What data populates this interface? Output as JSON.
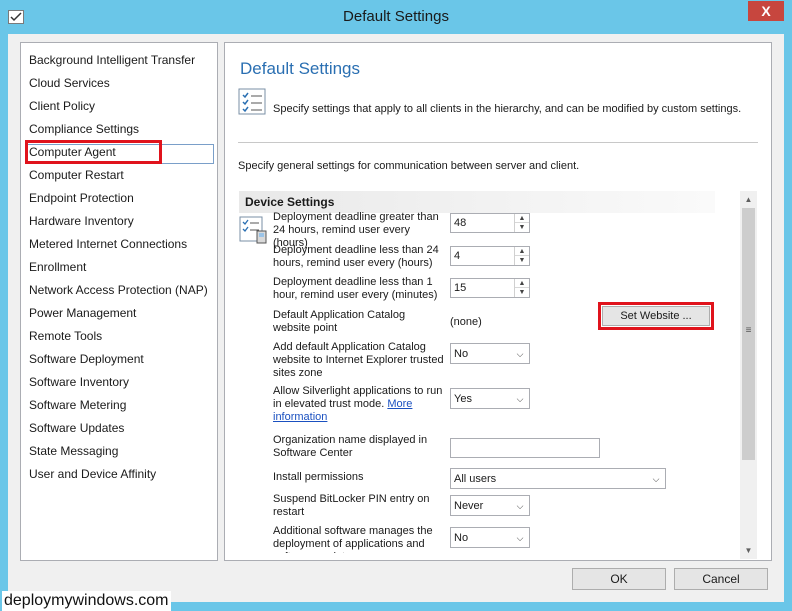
{
  "window": {
    "title": "Default Settings",
    "close_label": "X"
  },
  "nav": {
    "items": [
      "Background Intelligent Transfer",
      "Cloud Services",
      "Client Policy",
      "Compliance Settings",
      "Computer Agent",
      "Computer Restart",
      "Endpoint Protection",
      "Hardware Inventory",
      "Metered Internet Connections",
      "Enrollment",
      "Network Access Protection (NAP)",
      "Power Management",
      "Remote Tools",
      "Software Deployment",
      "Software Inventory",
      "Software Metering",
      "Software Updates",
      "State Messaging",
      "User and Device Affinity"
    ],
    "selected": "Computer Agent"
  },
  "panel": {
    "title": "Default Settings",
    "description": "Specify settings that apply to all clients in the hierarchy, and can be modified by custom settings.",
    "subdescription": "Specify general settings for communication between server and client.",
    "group_title": "Device Settings",
    "settings": {
      "deadline_greater_label": "Deployment deadline greater than 24 hours, remind user every (hours)",
      "deadline_greater_value": "48",
      "deadline_less24_label": "Deployment deadline less than 24 hours, remind user every (hours)",
      "deadline_less24_value": "4",
      "deadline_less1_label": "Deployment deadline less than 1 hour, remind user every (minutes)",
      "deadline_less1_value": "15",
      "catalog_point_label": "Default Application Catalog website point",
      "catalog_point_value": "(none)",
      "set_website_label": "Set Website ...",
      "add_catalog_label": "Add default Application Catalog website to Internet Explorer trusted sites zone",
      "add_catalog_value": "No",
      "silverlight_label": "Allow Silverlight applications to run in elevated trust mode.",
      "silverlight_link": "More information",
      "silverlight_value": "Yes",
      "org_name_label": "Organization name displayed in Software Center",
      "org_name_value": "",
      "install_perm_label": "Install permissions",
      "install_perm_value": "All users",
      "bitlocker_label": "Suspend BitLocker PIN entry on restart",
      "bitlocker_value": "Never",
      "additional_sw_label": "Additional software manages the deployment of applications and software updates",
      "additional_sw_value": "No"
    }
  },
  "buttons": {
    "ok": "OK",
    "cancel": "Cancel"
  },
  "watermark": "deploymywindows.com",
  "colors": {
    "title_bar": "#6ac6e8",
    "highlight": "#e0131c",
    "heading": "#2a6fb2",
    "close": "#c7463e"
  }
}
